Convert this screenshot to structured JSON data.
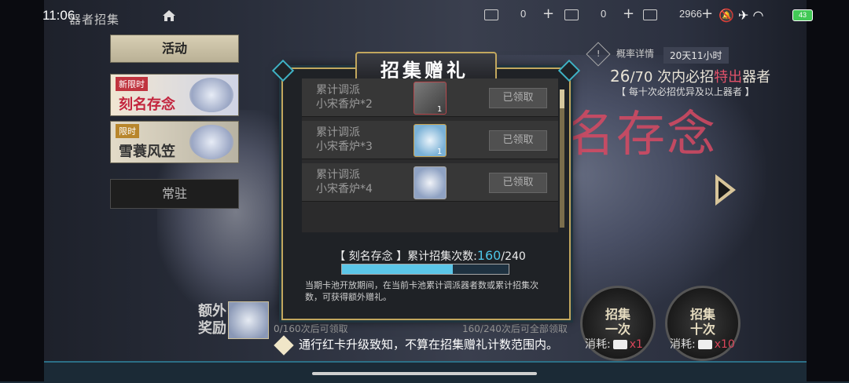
{
  "status_bar": {
    "time": "11:06",
    "battery": "43"
  },
  "header": {
    "title": "器者招集",
    "resources": [
      {
        "icon": "red-ticket-icon",
        "value": "0"
      },
      {
        "icon": "gold-coin-icon",
        "value": "0"
      },
      {
        "icon": "scroll-icon",
        "value": "2966"
      }
    ]
  },
  "tabs": {
    "activity": "活动",
    "banner_1": {
      "tag": "新限时",
      "name": "刻名存念"
    },
    "banner_2": {
      "tag": "限时",
      "name": "雪蓑风笠"
    },
    "standing": "常驻"
  },
  "info": {
    "rate_label": "概率详情",
    "time_left": "20天11小时",
    "pity_count": "26",
    "pity_total": "/70",
    "pity_text_1": "次内必招",
    "pity_text_red": "特出",
    "pity_text_2": "器者",
    "pity_sub": "【 每十次必招优异及以上器者 】"
  },
  "modal": {
    "title": "招集赠礼",
    "rewards": [
      {
        "line1": "累计调派",
        "line2": "小宋香炉*2",
        "icon": "incense-burner-icon",
        "count": "1",
        "button": "已领取"
      },
      {
        "line1": "累计调派",
        "line2": "小宋香炉*3",
        "icon": "character-portrait-icon",
        "count": "1",
        "button": "已领取"
      },
      {
        "line1": "累计调派",
        "line2": "小宋香炉*4",
        "icon": "character-portrait-icon",
        "count": "",
        "button": "已领取"
      }
    ],
    "count_label": "【 刻名存念 】累计招集次数:",
    "count_current": "160",
    "count_total": "/240",
    "progress": 0.667,
    "description": "当期卡池开放期间，在当前卡池累计调派器者数或累计招集次数，可获得额外赠礼。"
  },
  "extra": {
    "label_1": "额外",
    "label_2": "奖励",
    "progress_1": "0/160次后可领取",
    "progress_2": "160/240次后可全部领取"
  },
  "draw": {
    "one_line1": "招集",
    "one_line2": "一次",
    "ten_line1": "招集",
    "ten_line2": "十次",
    "cost_label": "消耗:",
    "cost_one": "x1",
    "cost_ten": "x10"
  },
  "notice": "通行红卡升级致知，不算在招集赠礼计数范围内。",
  "background": {
    "calligraphy": "名存念"
  },
  "colors": {
    "accent_gold": "#c2a75e",
    "accent_cyan": "#5bc6e8",
    "accent_red": "#d84a63"
  }
}
